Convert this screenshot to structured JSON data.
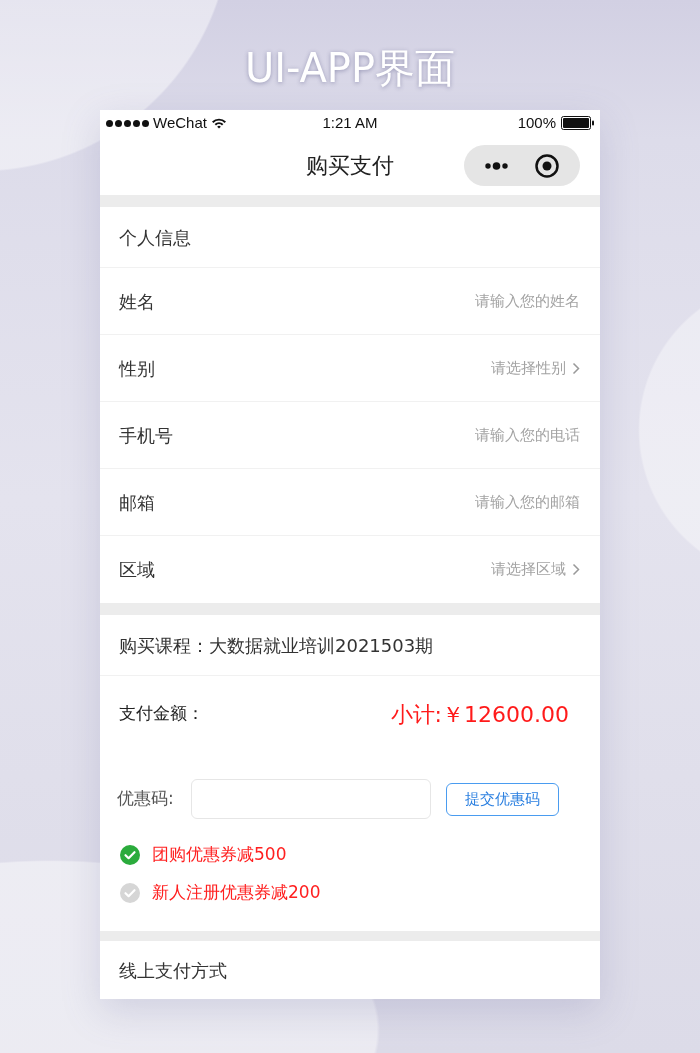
{
  "page_title": "UI-APP界面",
  "status_bar": {
    "carrier": "WeChat",
    "time": "1:21 AM",
    "battery": "100%"
  },
  "nav_bar": {
    "title": "购买支付"
  },
  "personal_info": {
    "heading": "个人信息",
    "fields": [
      {
        "kind": "input",
        "label": "姓名",
        "placeholder": "请输入您的姓名"
      },
      {
        "kind": "select",
        "label": "性别",
        "placeholder": "请选择性别"
      },
      {
        "kind": "input",
        "label": "手机号",
        "placeholder": "请输入您的电话"
      },
      {
        "kind": "input",
        "label": "邮箱",
        "placeholder": "请输入您的邮箱"
      },
      {
        "kind": "select",
        "label": "区域",
        "placeholder": "请选择区域"
      }
    ]
  },
  "course": {
    "text": "购买课程：大数据就业培训2021503期"
  },
  "payment": {
    "label": "支付金额：",
    "subtotal": "小计:￥12600.00"
  },
  "coupon": {
    "label": "优惠码:",
    "submit_button": "提交优惠码",
    "offers": [
      {
        "text": "团购优惠券减500",
        "checked": true
      },
      {
        "text": "新人注册优惠券减200",
        "checked": false
      }
    ]
  },
  "online_payment": {
    "heading": "线上支付方式"
  }
}
